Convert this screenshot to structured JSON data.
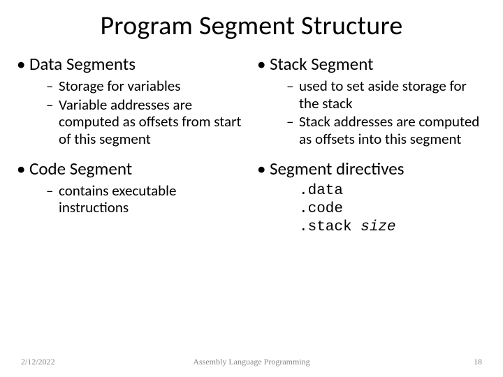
{
  "title": "Program Segment Structure",
  "left": {
    "h1": "Data Segments",
    "b1a": "Storage for variables",
    "b1b": "Variable addresses are computed as offsets from start of this segment",
    "h2": "Code Segment",
    "b2a": "contains executable instructions"
  },
  "right": {
    "h1": "Stack Segment",
    "b1a": "used to set aside storage for the stack",
    "b1b": "Stack addresses are computed as offsets into this segment",
    "h2": "Segment directives",
    "d1": ".data",
    "d2": ".code",
    "d3": ".stack ",
    "d3s": "size"
  },
  "footer": {
    "date": "2/12/2022",
    "title": "Assembly Language Programming",
    "page": "18"
  }
}
